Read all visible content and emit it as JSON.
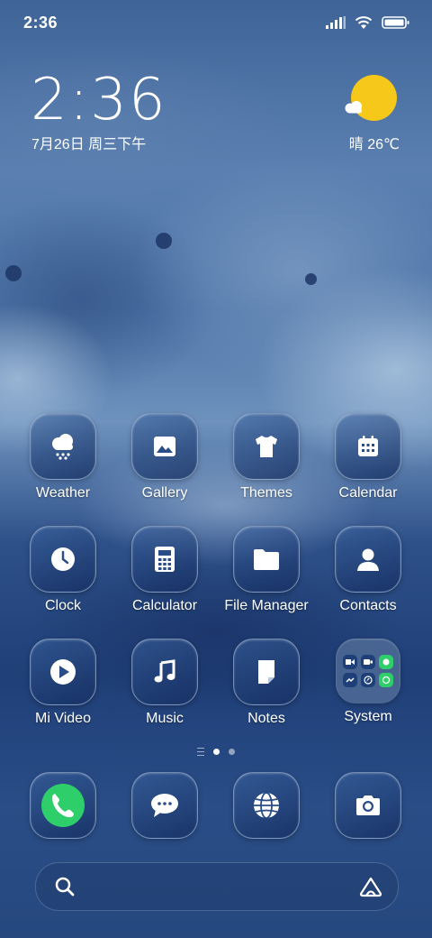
{
  "status_bar": {
    "time": "2:36"
  },
  "clock_widget": {
    "time": "2:36",
    "date": "7月26日 周三下午"
  },
  "weather_widget": {
    "text": "晴 26℃",
    "icon": "sunny-icon"
  },
  "apps": [
    {
      "label": "Weather",
      "icon": "weather-snow-icon"
    },
    {
      "label": "Gallery",
      "icon": "gallery-icon"
    },
    {
      "label": "Themes",
      "icon": "tshirt-icon"
    },
    {
      "label": "Calendar",
      "icon": "calendar-icon"
    },
    {
      "label": "Clock",
      "icon": "clock-icon"
    },
    {
      "label": "Calculator",
      "icon": "calculator-icon"
    },
    {
      "label": "File Manager",
      "icon": "folder-icon"
    },
    {
      "label": "Contacts",
      "icon": "contact-icon"
    },
    {
      "label": "Mi Video",
      "icon": "play-icon"
    },
    {
      "label": "Music",
      "icon": "music-note-icon"
    },
    {
      "label": "Notes",
      "icon": "note-icon"
    },
    {
      "label": "System",
      "icon": "folder-system-icon"
    }
  ],
  "dock": [
    {
      "name": "phone",
      "icon": "phone-icon",
      "color": "#2ecf6a"
    },
    {
      "name": "messages",
      "icon": "chat-bubble-icon"
    },
    {
      "name": "browser",
      "icon": "globe-icon"
    },
    {
      "name": "camera",
      "icon": "camera-icon"
    }
  ],
  "page_indicator": {
    "pages": 2,
    "current": 1
  },
  "search_bar": {
    "left_icon": "search-icon",
    "right_icon": "assistant-icon"
  },
  "colors": {
    "sun": "#f6c81a",
    "phone_green": "#2ecf6a",
    "background_blue": "#2a4d87"
  }
}
